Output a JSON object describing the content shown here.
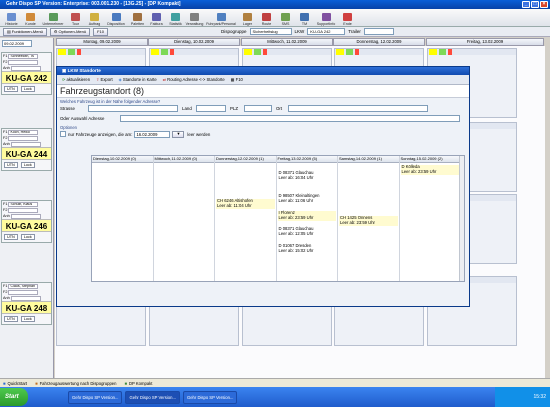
{
  "window": {
    "title": "Gehr Dispo SP Version: Enterprise: 003.001.230 - [13G.25] - [DP Kompakt]"
  },
  "toolbar": {
    "items": [
      {
        "label": "Historie",
        "color": "#6a8fd0"
      },
      {
        "label": "Kunde",
        "color": "#d08a3a"
      },
      {
        "label": "Unternehmer",
        "color": "#5a9a5a"
      },
      {
        "label": "Tour",
        "color": "#c05050"
      },
      {
        "label": "Auftrag",
        "color": "#d0b040"
      },
      {
        "label": "Disposition",
        "color": "#4a7ac0"
      },
      {
        "label": "Paletten",
        "color": "#a07040"
      },
      {
        "label": "Faktura",
        "color": "#6060b0"
      },
      {
        "label": "Statistik",
        "color": "#40a0a0"
      },
      {
        "label": "Verwaltung",
        "color": "#808080"
      },
      {
        "label": "Fuhrpark/Personal",
        "color": "#5080c0"
      },
      {
        "label": "Lager",
        "color": "#b08040"
      },
      {
        "label": "Route",
        "color": "#c04040"
      },
      {
        "label": "SMS",
        "color": "#70a050"
      },
      {
        "label": "TM",
        "color": "#4070b0"
      },
      {
        "label": "SupportInfo",
        "color": "#8050a0"
      },
      {
        "label": "Ende",
        "color": "#d04040"
      }
    ]
  },
  "toolbar2": {
    "funktionen": "Funktionen-Menü",
    "optionen": "Optionen-Menü",
    "f10": "F10",
    "dispogruppe": "Dispogruppe",
    "dispogruppe_value": "Sicherheitslug",
    "lkw": "LKW",
    "lkw_value": "KU-GA 242",
    "trailer": "Trailer"
  },
  "date_field": "09.02.2009",
  "days": [
    "Montag, 09.02.2009",
    "Dienstag, 10.02.2009",
    "Mittwoch, 11.02.2009",
    "Donnerstag, 12.02.2009",
    "Freitag, 13.02.2009"
  ],
  "vehicles": [
    {
      "driver": "Schneeloth, Ts",
      "plate": "KU-GA 242",
      "utn": "UTN",
      "lock": "Lock"
    },
    {
      "driver": "Koch, Heiko",
      "plate": "KU-GA 244",
      "utn": "UTN",
      "lock": "Lock"
    },
    {
      "driver": "Schulit, Klaus",
      "plate": "KU-GA 246",
      "utn": "UTN",
      "lock": "Lock"
    },
    {
      "driver": "Claus, Stephan",
      "plate": "KU-GA 248",
      "utn": "UTN",
      "lock": "Lock"
    }
  ],
  "dialog": {
    "title": "LKW Standorte",
    "tools": [
      "aktualisieren",
      "Export",
      "Standorte in Karte",
      "Routing Adresse <-> Standorte",
      "F10"
    ],
    "heading": "Fahrzeugstandort (8)",
    "question": "Welches Fahrzeug ist in der Nähe folgender Adresse?",
    "strasse": "Strasse",
    "land": "Land",
    "plz": "PLZ",
    "ort": "Ort",
    "auswahl": "Oder Auswahl Adresse",
    "optionen": "Optionen",
    "nur_label": "nur Fahrzeuge anzeigen, die am:",
    "nur_date": "16.02.2009",
    "leer": "leer werden",
    "columns": [
      "Dienstag,10.02.2009 (0)",
      "Mittwoch,11.02.2009 (0)",
      "Donnerstag,12.02.2009 (1)",
      "Freitag,13.02.2009 (5)",
      "Samstag,14.02.2009 (1)",
      "Sonntag,15.02.2009 (2)"
    ],
    "entries": {
      "thu": [
        {
          "a": "CH 6246 Altishofen",
          "b": "Leer ab: 11:04 Uhr"
        }
      ],
      "fri": [
        {
          "a": "D 08371 Glauchau",
          "b": "Leer ab: 16:04 Uhr"
        },
        {
          "a": "D 98507 Kleinaltingen",
          "b": "Leer ab: 11:06 Uhr"
        },
        {
          "a": "I Florenz",
          "b": "Leer ab: 23:59 Uhr"
        },
        {
          "a": "D 08371 Glauchau",
          "b": "Leer ab: 12:05 Uhr"
        },
        {
          "a": "D 01067 Dresden",
          "b": "Leer ab: 15:02 Uhr"
        }
      ],
      "sat": [
        {
          "a": "CH 1425 Onnens",
          "b": "Leer ab: 23:59 Uhr"
        }
      ],
      "sun": [
        {
          "a": "D Kölleda",
          "b": "Leer ab: 23:59 Uhr"
        }
      ]
    }
  },
  "statusbar": {
    "items": [
      "QuickStart",
      "Fahrzeugauswertung nach Dispogruppen",
      "DP Kompakt"
    ]
  },
  "taskbar": {
    "start": "Start",
    "tasks": [
      "Gehr Dispo SP Version...",
      "Gehr Dispo SP Version...",
      "Gehr Dispo SP Version..."
    ],
    "clock": "15:32"
  }
}
